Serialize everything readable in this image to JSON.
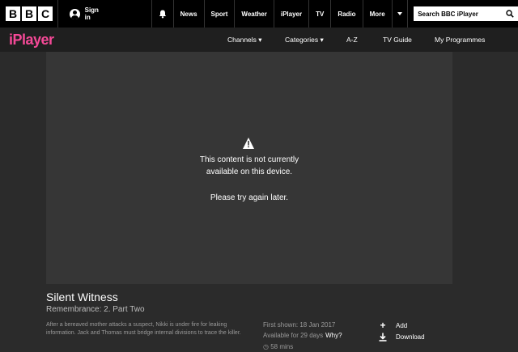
{
  "bbc_bar": {
    "logo_letters": [
      "B",
      "B",
      "C"
    ],
    "sign_in": "Sign in",
    "nav": [
      "News",
      "Sport",
      "Weather",
      "iPlayer",
      "TV",
      "Radio",
      "More"
    ],
    "search_placeholder": "Search BBC iPlayer"
  },
  "iplayer_bar": {
    "logo": "iPlayer",
    "nav": [
      "Channels ▾",
      "Categories ▾",
      "A-Z",
      "TV Guide",
      "My Programmes"
    ]
  },
  "player": {
    "message_line1": "This content is not currently",
    "message_line2": "available on this device.",
    "message_line3": "Please try again later."
  },
  "programme": {
    "title": "Silent Witness",
    "episode": "Remembrance: 2. Part Two",
    "description": "After a bereaved mother attacks a suspect, Nikki is under fire for leaking information. Jack and Thomas must bridge internal divisions to trace the killer.",
    "first_shown": "First shown: 18 Jan 2017",
    "availability": "Available for 29 days",
    "why_link": "Why?",
    "duration": "58 mins"
  },
  "actions": {
    "add": "Add",
    "download": "Download"
  },
  "colors": {
    "iplayer_pink": "#f54997",
    "page_bg": "#2b2b2b",
    "player_bg": "#363636"
  }
}
